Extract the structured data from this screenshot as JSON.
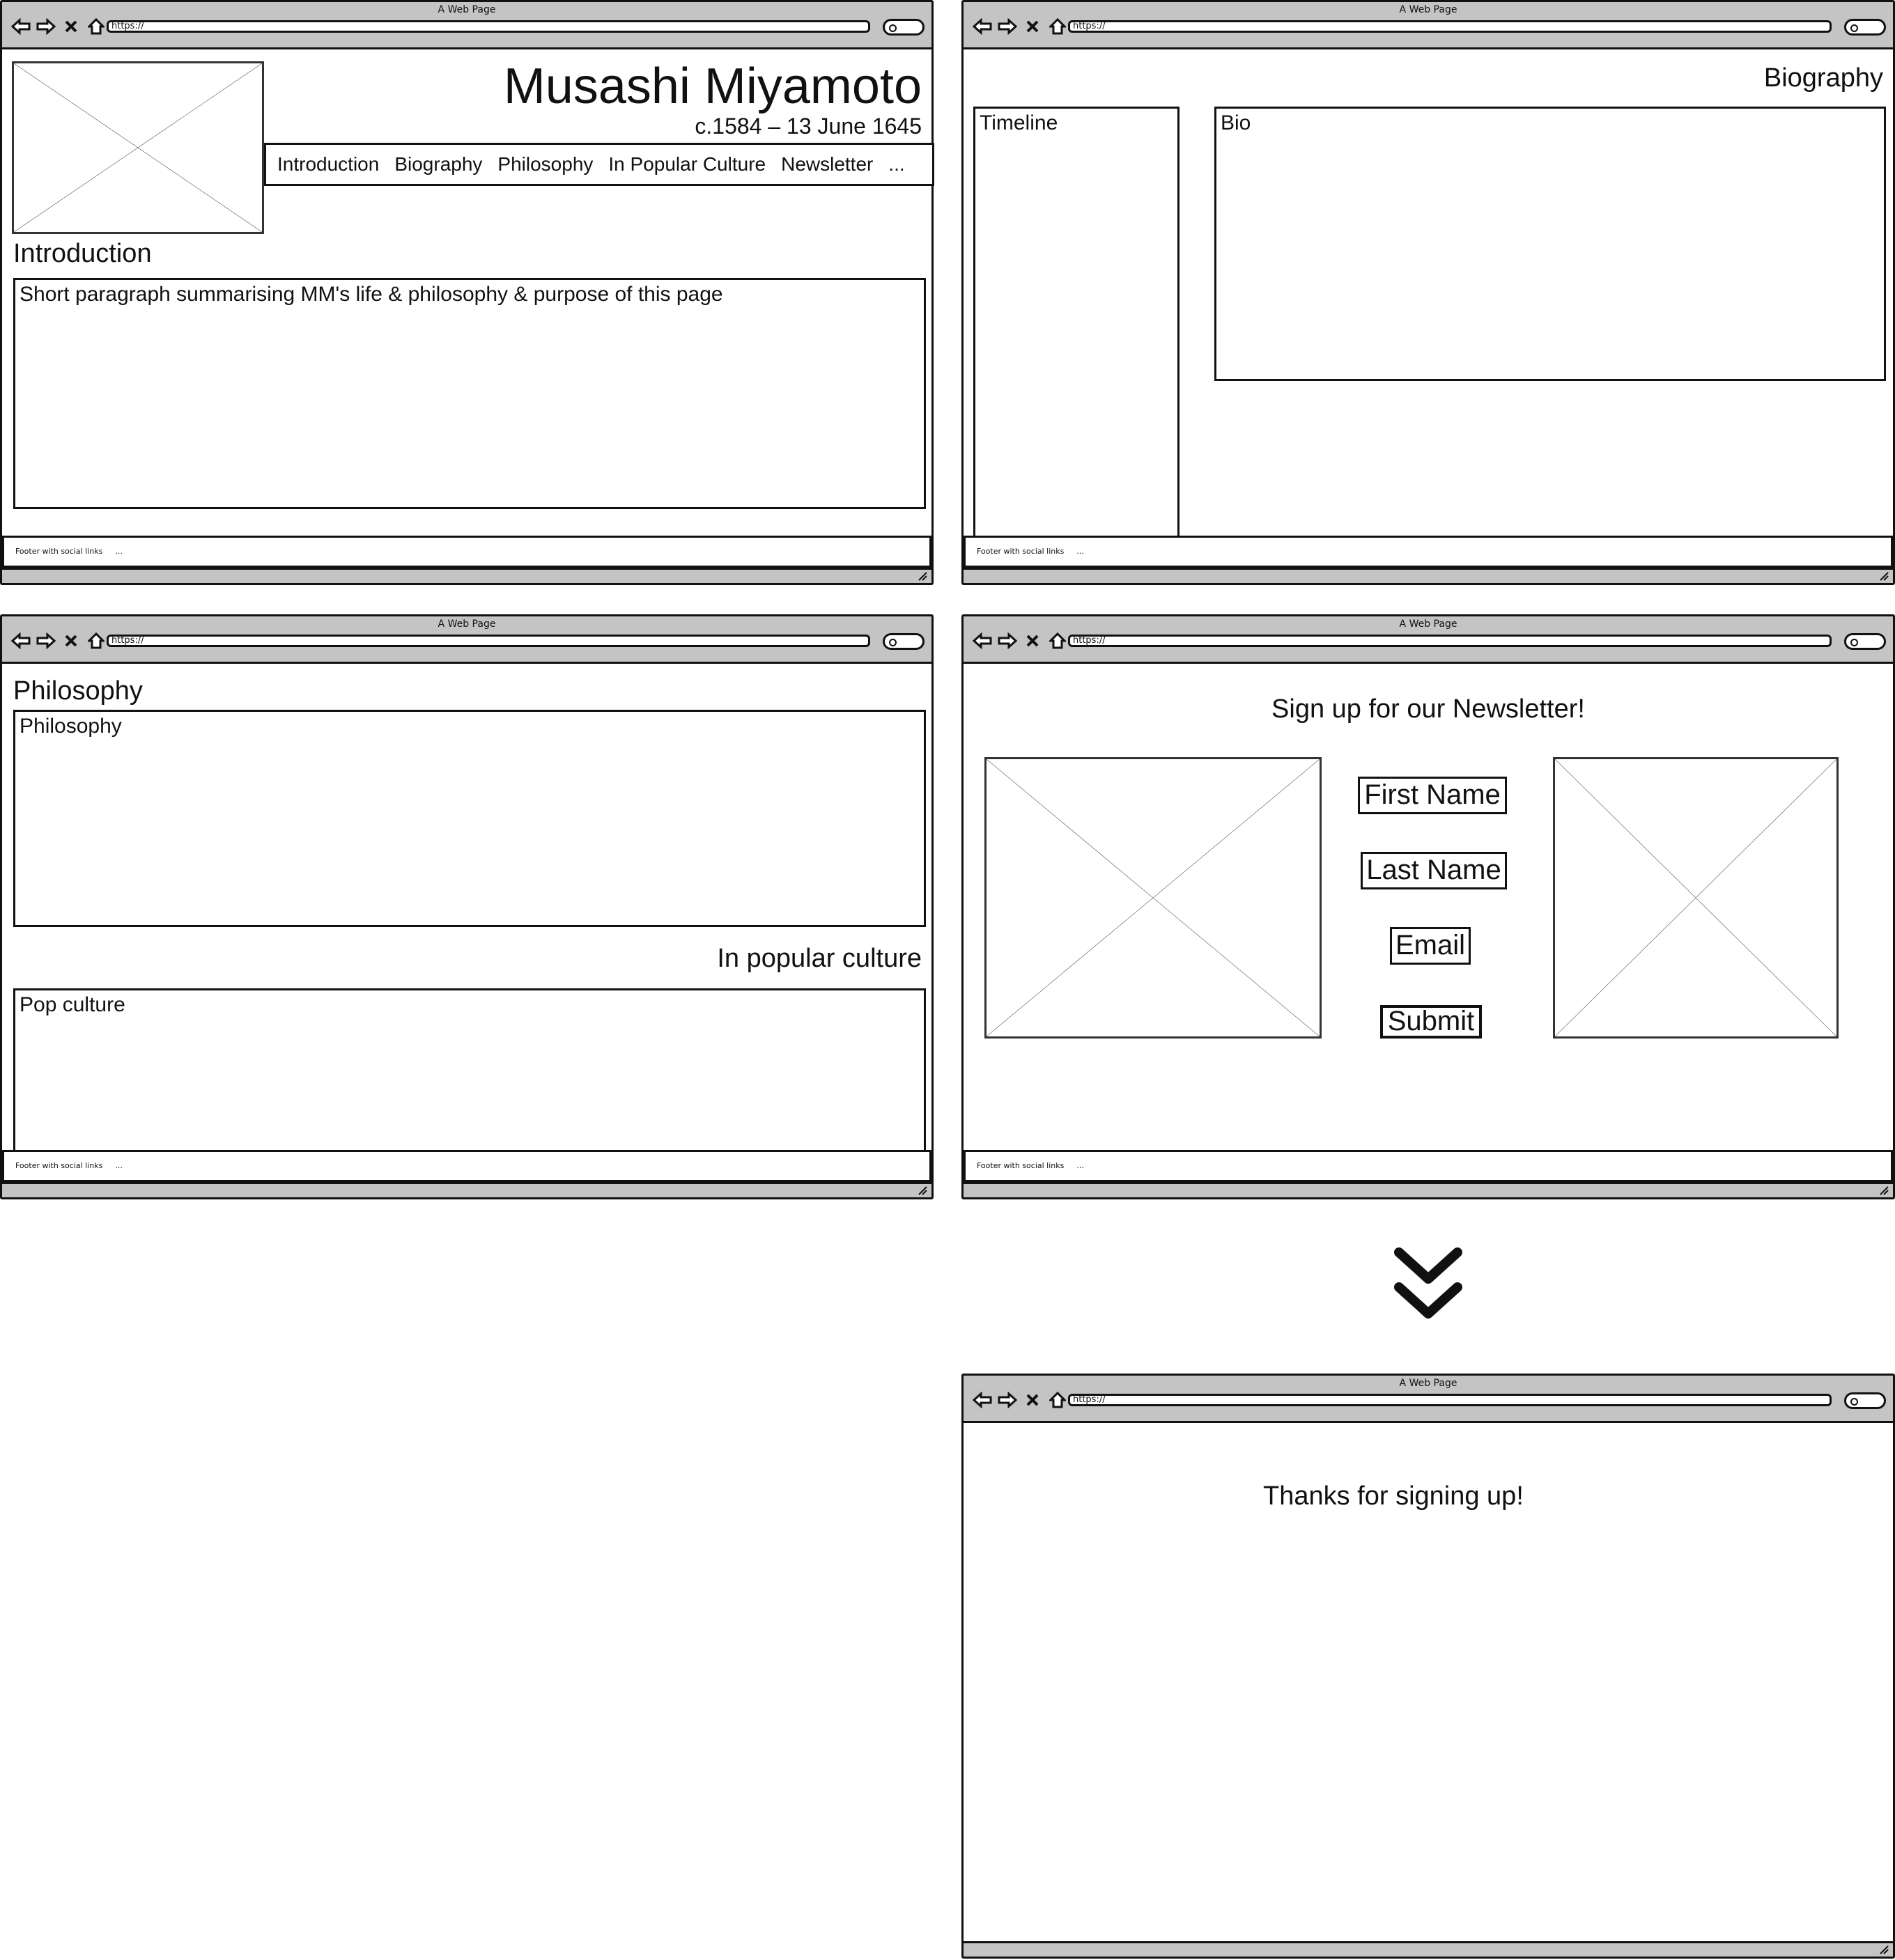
{
  "browser": {
    "window_title": "A Web Page",
    "url": "https://"
  },
  "footer": {
    "text": "Footer with social links",
    "dots": "..."
  },
  "home": {
    "site_title": "Musashi Miyamoto",
    "dates": "c.1584 – 13 June 1645",
    "nav": [
      "Introduction",
      "Biography",
      "Philosophy",
      "In Popular Culture",
      "Newsletter",
      "..."
    ],
    "intro_heading": "Introduction",
    "intro_text": "Short paragraph summarising MM's life & philosophy & purpose of this page"
  },
  "biography": {
    "heading": "Biography",
    "timeline_label": "Timeline",
    "bio_label": "Bio"
  },
  "philosophy": {
    "heading": "Philosophy",
    "box_label": "Philosophy",
    "pop_heading": "In popular culture",
    "pop_label": "Pop culture"
  },
  "newsletter": {
    "heading": "Sign up for our Newsletter!",
    "first_name": "First Name",
    "last_name": "Last Name",
    "email": "Email",
    "submit": "Submit"
  },
  "thanks": {
    "message": "Thanks for signing up!"
  },
  "icons": {
    "back": "arrow-left-icon",
    "forward": "arrow-right-icon",
    "stop": "close-icon",
    "home": "home-icon",
    "search": "search-icon",
    "transition": "double-chevron-down-icon"
  }
}
